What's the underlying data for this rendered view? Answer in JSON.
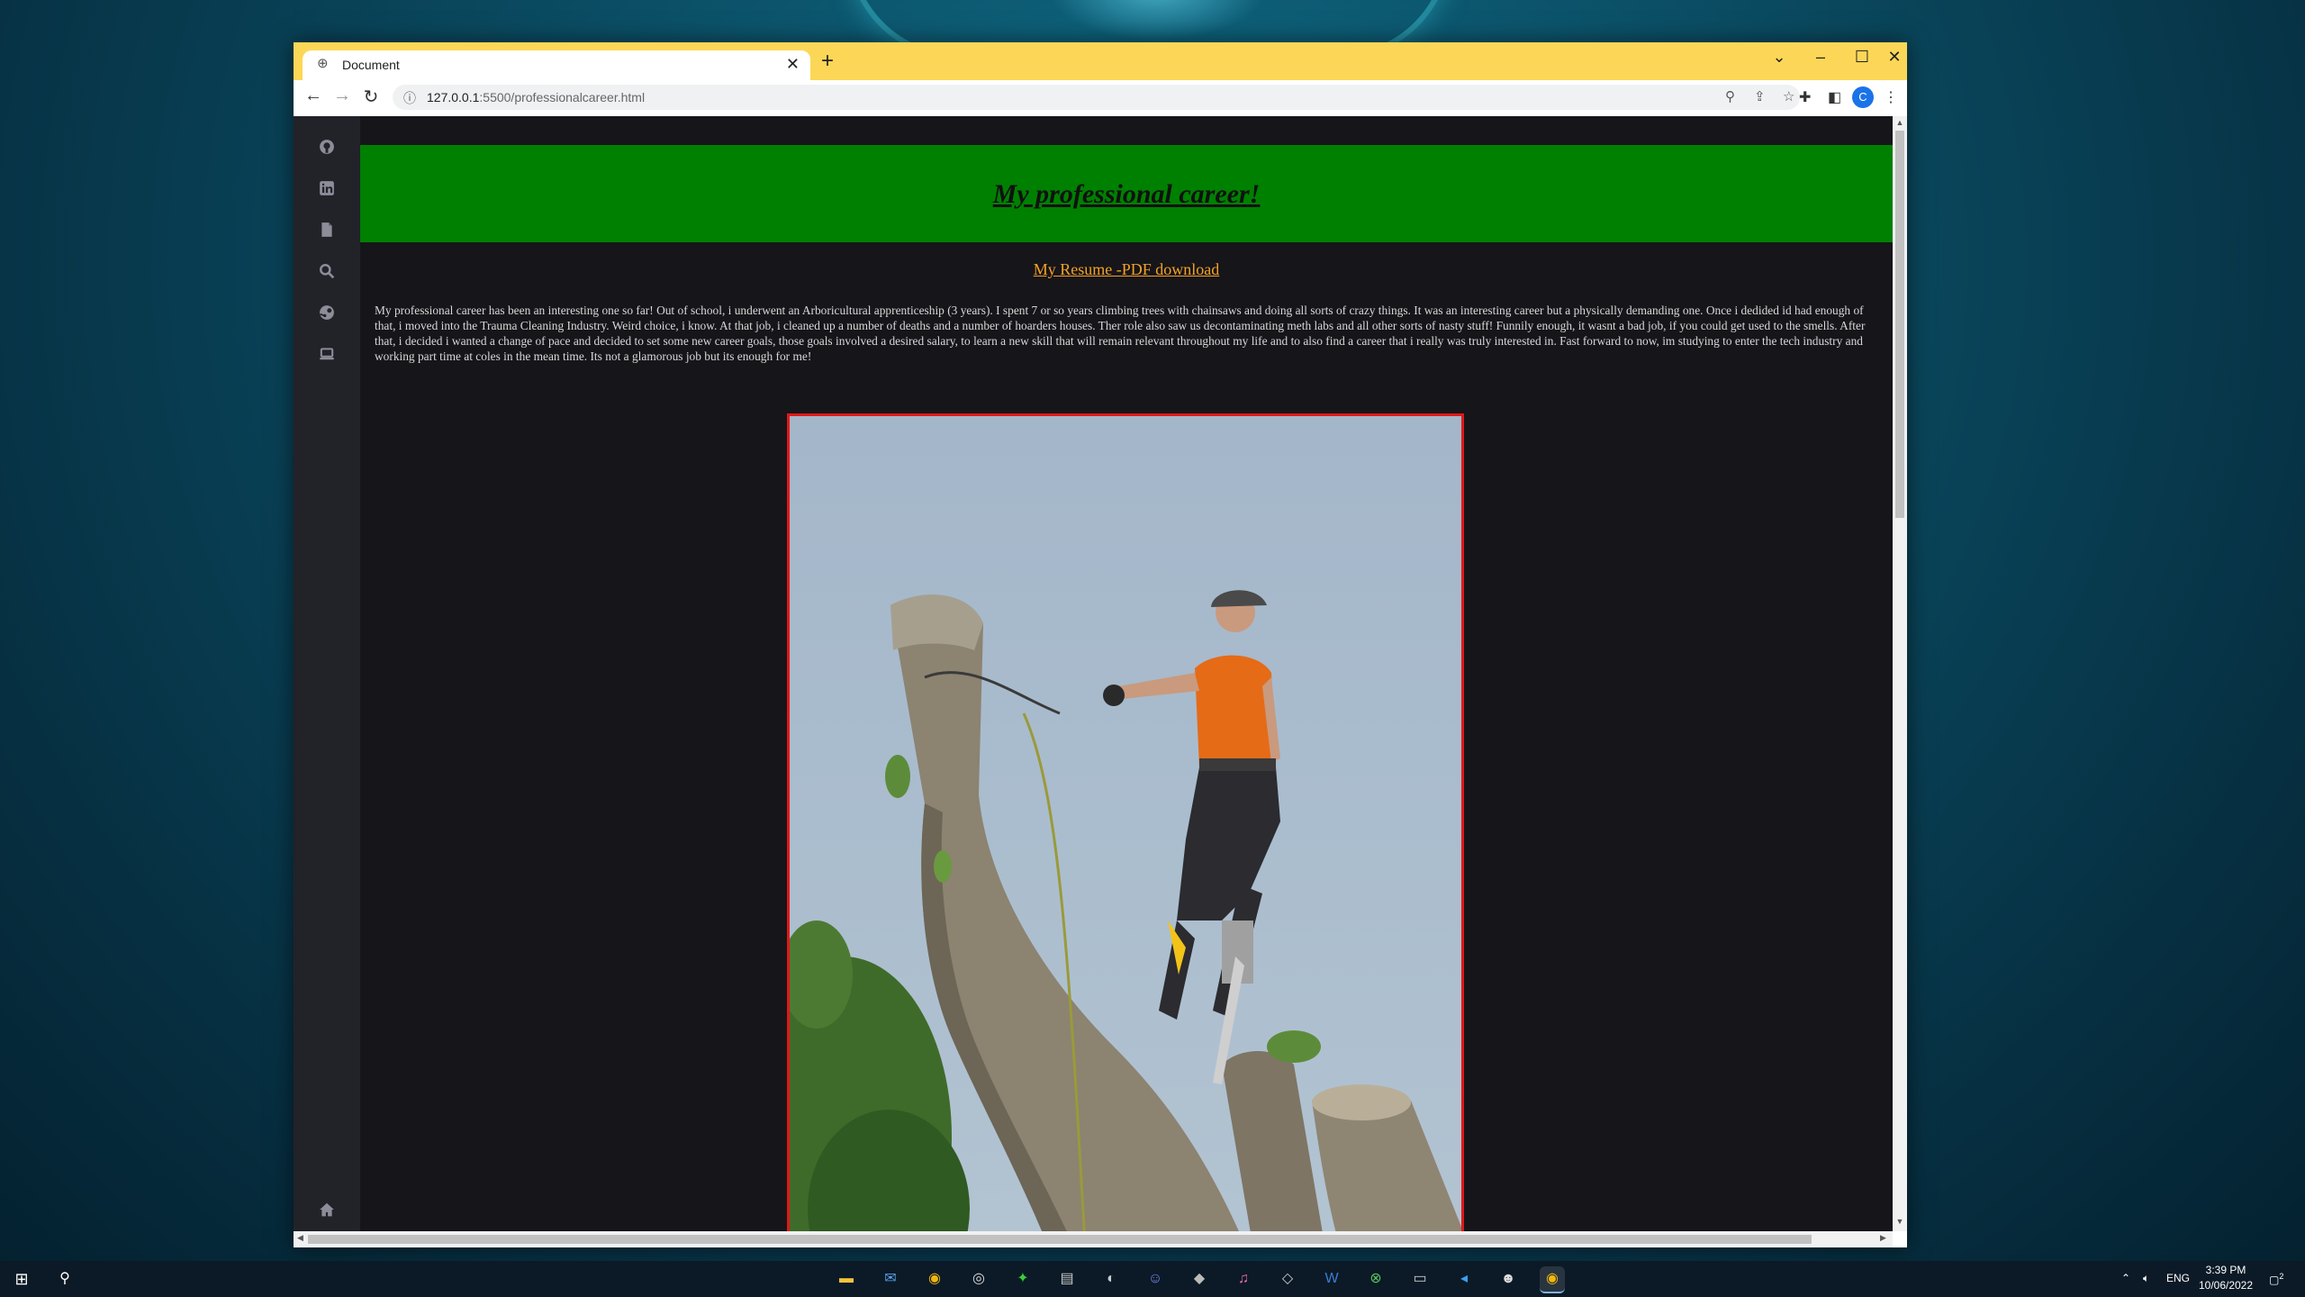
{
  "browser": {
    "tab_title": "Document",
    "url_host": "127.0.0.1",
    "url_rest": ":5500/professionalcareer.html",
    "new_tab": "+",
    "profile_initial": "C"
  },
  "page": {
    "heading": "My professional career!",
    "resume_link": "My Resume -PDF download",
    "bio": "My professional career has been an interesting one so far! Out of school, i underwent an Arboricultural apprenticeship (3 years). I spent 7 or so years climbing trees with chainsaws and doing all sorts of crazy things. It was an interesting career but a physically demanding one. Once i dedided id had enough of that, i moved into the Trauma Cleaning Industry. Weird choice, i know. At that job, i cleaned up a number of deaths and a number of hoarders houses. Ther role also saw us decontaminating meth labs and all other sorts of nasty stuff! Funnily enough, it wasnt a bad job, if you could get used to the smells. After that, i decided i wanted a change of pace and decided to set some new career goals, those goals involved a desired salary, to learn a new skill that will remain relevant throughout my life and to also find a career that i really was truly interested in. Fast forward to now, im studying to enter the tech industry and working part time at coles in the mean time. Its not a glamorous job but its enough for me!",
    "colors": {
      "banner": "#008000",
      "link": "#f4a227",
      "photo_border": "#e01818",
      "background": "#161519"
    }
  },
  "sidebar": {
    "icons": [
      "github-icon",
      "linkedin-icon",
      "document-icon",
      "search-icon",
      "steam-icon",
      "laptop-icon",
      "home-icon"
    ]
  },
  "taskbar": {
    "lang": "ENG",
    "time": "3:39 PM",
    "date": "10/06/2022",
    "notification_count": "2"
  }
}
